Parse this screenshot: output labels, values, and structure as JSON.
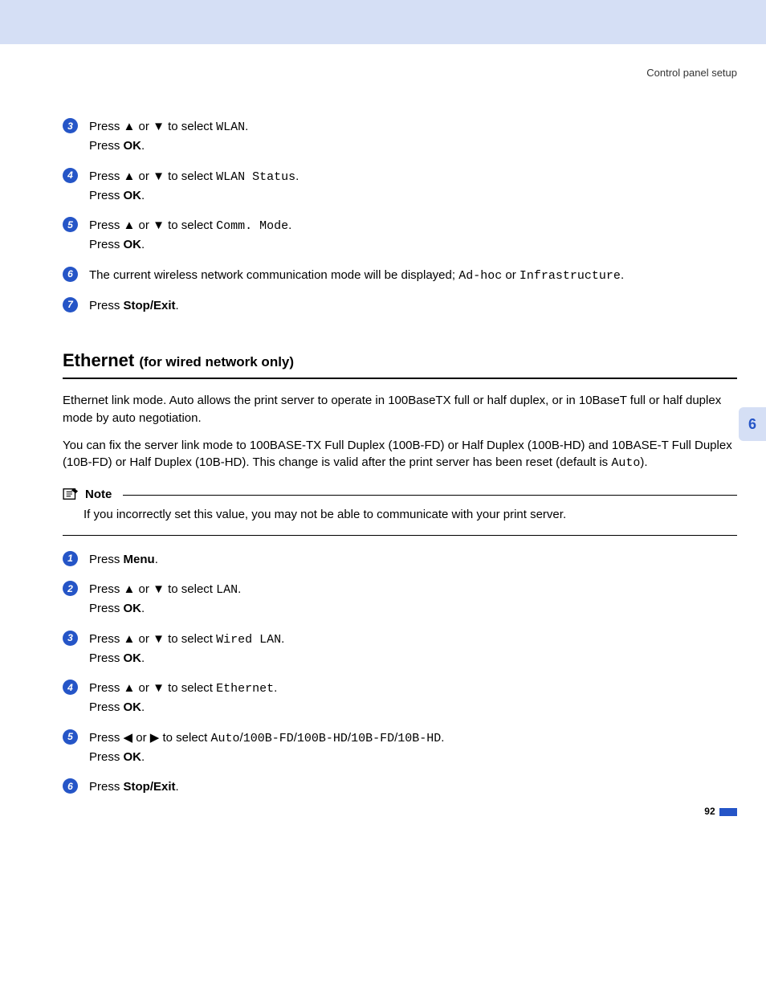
{
  "header": "Control panel setup",
  "chapter": "6",
  "pageNumber": "92",
  "glyph": {
    "up": "▲",
    "down": "▼",
    "left": "◀",
    "right": "▶"
  },
  "top_steps": [
    {
      "n": "3",
      "pre": "Press ",
      "mid": " or ",
      "post": " to select ",
      "code": "WLAN",
      "after": ".",
      "second": "Press <b>OK</b>."
    },
    {
      "n": "4",
      "pre": "Press ",
      "mid": " or ",
      "post": " to select ",
      "code": "WLAN Status",
      "after": ".",
      "second": "Press <b>OK</b>."
    },
    {
      "n": "5",
      "pre": "Press ",
      "mid": " or ",
      "post": " to select ",
      "code": "Comm. Mode",
      "after": ".",
      "second": "Press <b>OK</b>."
    }
  ],
  "step6": {
    "n": "6",
    "text_a": "The current wireless network communication mode will be displayed; ",
    "code_a": "Ad-hoc",
    "text_b": " or ",
    "code_b": "Infrastructure",
    "text_c": "."
  },
  "step7": {
    "n": "7",
    "text_a": "Press ",
    "bold": "Stop/Exit",
    "text_b": "."
  },
  "section": {
    "title": "Ethernet ",
    "subtitle": "(for wired network only)"
  },
  "para1": "Ethernet link mode. Auto allows the print server to operate in 100BaseTX full or half duplex, or in 10BaseT full or half duplex mode by auto negotiation.",
  "para2_a": "You can fix the server link mode to 100BASE-TX Full Duplex (100B-FD) or Half Duplex (100B-HD) and 10BASE-T Full Duplex (10B-FD) or Half Duplex (10B-HD). This change is valid after the print server has been reset (default is ",
  "para2_code": "Auto",
  "para2_b": ").",
  "note": {
    "title": "Note",
    "body": "If you incorrectly set this value, you may not be able to communicate with your print server."
  },
  "bottom": {
    "s1": {
      "n": "1",
      "text_a": "Press ",
      "bold": "Menu",
      "text_b": "."
    },
    "s2": {
      "n": "2",
      "code": "LAN"
    },
    "s3": {
      "n": "3",
      "code": "Wired LAN"
    },
    "s4": {
      "n": "4",
      "code": "Ethernet"
    },
    "s5": {
      "n": "5",
      "opts": [
        "Auto",
        "100B-FD",
        "100B-HD",
        "10B-FD",
        "10B-HD"
      ]
    },
    "s6": {
      "n": "6",
      "text_a": "Press ",
      "bold": "Stop/Exit",
      "text_b": "."
    }
  },
  "common": {
    "press_ok": "Press <b>OK</b>.",
    "to_select": " to select ",
    "press": "Press ",
    "or": " or ",
    "slash": "/"
  }
}
